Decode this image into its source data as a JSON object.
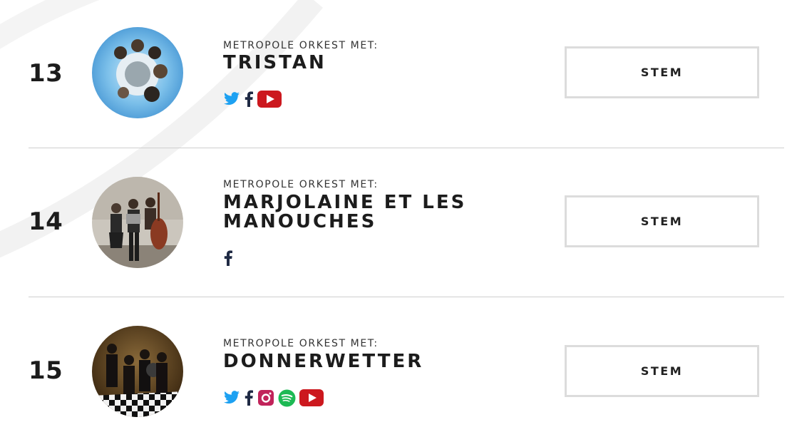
{
  "colors": {
    "twitter": "#1da1f2",
    "facebook": "#1f2a44",
    "instagram": "#c1235a",
    "spotify": "#1db954",
    "youtube": "#cc181e",
    "button_border": "#dcdcdc"
  },
  "rows": [
    {
      "rank": "13",
      "subtitle": "METROPOLE ORKEST MET:",
      "name": "TRISTAN",
      "socials": [
        "twitter-icon",
        "facebook-icon",
        "youtube-icon"
      ],
      "button": "STEM"
    },
    {
      "rank": "14",
      "subtitle": "METROPOLE ORKEST MET:",
      "name": "MARJOLAINE ET LES MANOUCHES",
      "socials": [
        "facebook-icon"
      ],
      "button": "STEM"
    },
    {
      "rank": "15",
      "subtitle": "METROPOLE ORKEST MET:",
      "name": "DONNERWETTER",
      "socials": [
        "twitter-icon",
        "facebook-icon",
        "instagram-icon",
        "spotify-icon",
        "youtube-icon"
      ],
      "button": "STEM"
    }
  ]
}
